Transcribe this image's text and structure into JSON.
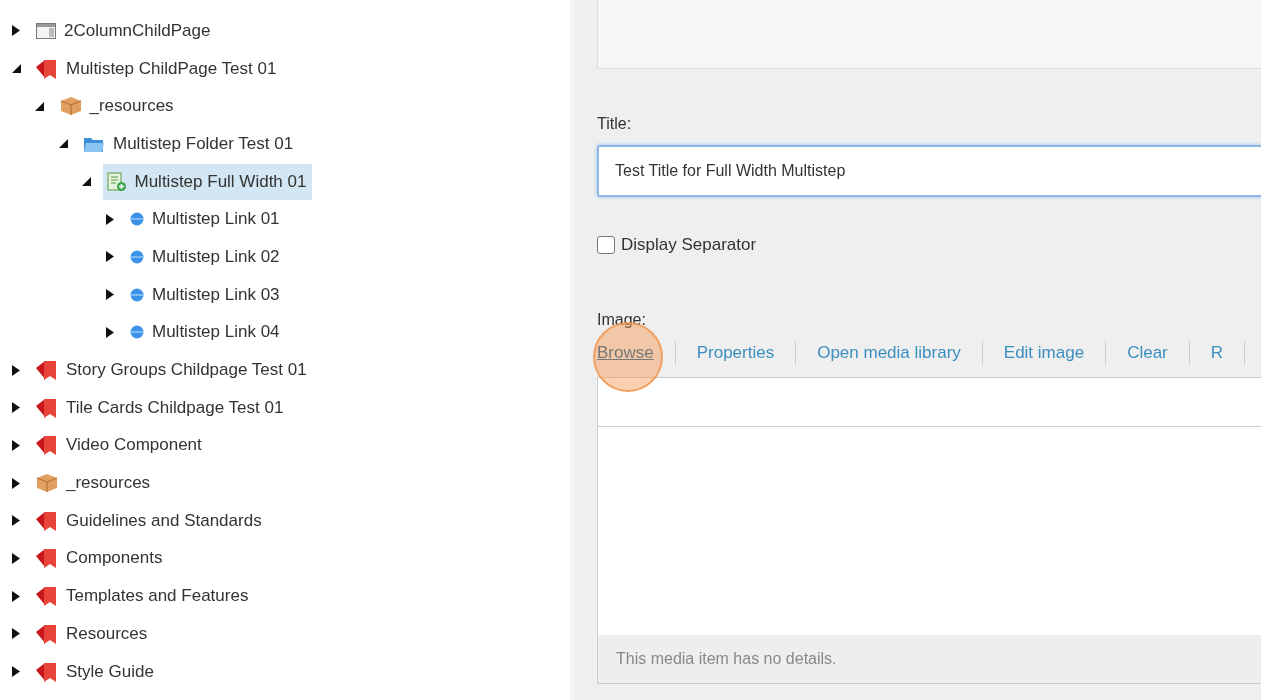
{
  "tree": [
    {
      "label": "2ColumnChildPage",
      "kind": "layout",
      "expanded": false,
      "selected": false
    },
    {
      "label": "Multistep ChildPage Test 01",
      "kind": "page",
      "expanded": true,
      "selected": false,
      "children": [
        {
          "label": "_resources",
          "kind": "package",
          "expanded": true,
          "selected": false,
          "children": [
            {
              "label": "Multistep Folder Test 01",
              "kind": "folder",
              "expanded": true,
              "selected": false,
              "children": [
                {
                  "label": "Multistep Full Width 01",
                  "kind": "form",
                  "expanded": true,
                  "selected": true,
                  "children": [
                    {
                      "label": "Multistep Link 01",
                      "kind": "link",
                      "expanded": false,
                      "selected": false
                    },
                    {
                      "label": "Multistep Link 02",
                      "kind": "link",
                      "expanded": false,
                      "selected": false
                    },
                    {
                      "label": "Multistep Link 03",
                      "kind": "link",
                      "expanded": false,
                      "selected": false
                    },
                    {
                      "label": "Multistep Link 04",
                      "kind": "link",
                      "expanded": false,
                      "selected": false
                    }
                  ]
                }
              ]
            }
          ]
        }
      ]
    },
    {
      "label": "Story Groups Childpage Test 01",
      "kind": "page",
      "expanded": false,
      "selected": false
    },
    {
      "label": "Tile Cards Childpage Test 01",
      "kind": "page",
      "expanded": false,
      "selected": false
    },
    {
      "label": "Video Component",
      "kind": "page",
      "expanded": false,
      "selected": false
    },
    {
      "label": "_resources",
      "kind": "package",
      "expanded": false,
      "selected": false
    },
    {
      "label": "Guidelines and Standards",
      "kind": "page",
      "expanded": false,
      "selected": false
    },
    {
      "label": "Components",
      "kind": "page",
      "expanded": false,
      "selected": false
    },
    {
      "label": "Templates and Features",
      "kind": "page",
      "expanded": false,
      "selected": false
    },
    {
      "label": "Resources",
      "kind": "page",
      "expanded": false,
      "selected": false
    },
    {
      "label": "Style Guide",
      "kind": "page",
      "expanded": false,
      "selected": false
    }
  ],
  "editor": {
    "title_label": "Title:",
    "title_value": "Test Title for Full Width Multistep",
    "separator": {
      "label": "Display Separator",
      "checked": false
    },
    "image_label": "Image:",
    "image_actions": [
      {
        "label": "Browse",
        "highlighted": true
      },
      {
        "label": "Properties",
        "highlighted": false
      },
      {
        "label": "Open media library",
        "highlighted": false
      },
      {
        "label": "Edit image",
        "highlighted": false
      },
      {
        "label": "Clear",
        "highlighted": false
      },
      {
        "label": "R",
        "highlighted": false
      }
    ],
    "media_details": "This media item has no details."
  }
}
